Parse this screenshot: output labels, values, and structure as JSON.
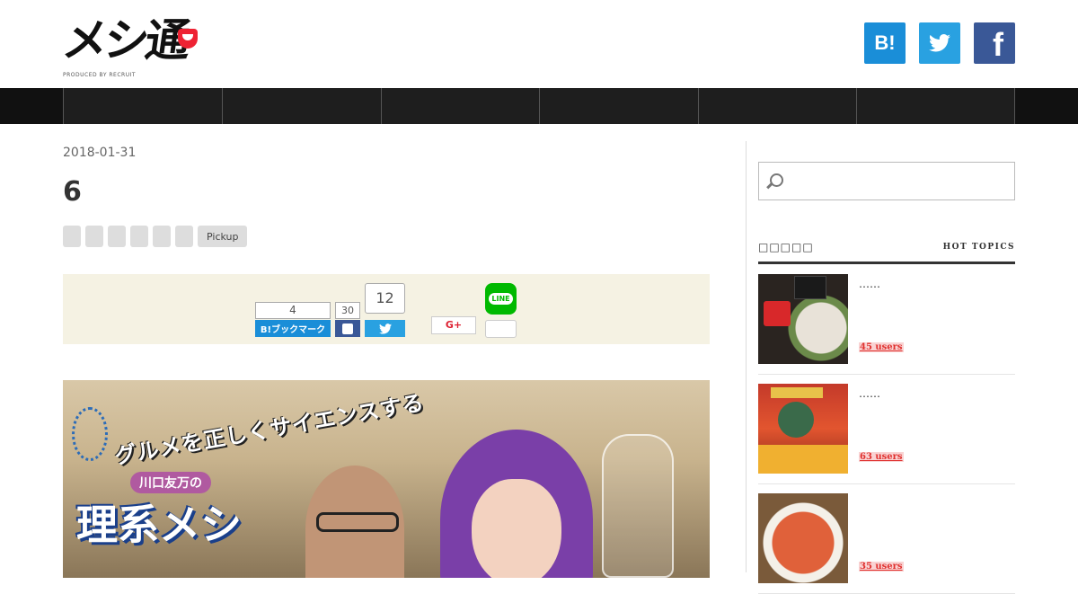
{
  "header": {
    "logo_text": "メシ通",
    "logo_sub": "PRODUCED BY RECRUIT",
    "social": {
      "hatena": "B!",
      "twitter": "twitter-bird",
      "facebook": "f"
    }
  },
  "nav": {
    "items": [
      "",
      "",
      "",
      "",
      "",
      ""
    ]
  },
  "article": {
    "date": "2018-01-31",
    "title": "6",
    "tags": [
      "",
      "",
      "",
      "",
      "",
      "",
      "Pickup"
    ],
    "share": {
      "hatena_count": "4",
      "hatena_label": "B!ブックマーク",
      "facebook_count": "30",
      "twitter_count": "12",
      "google_label": "G+",
      "line_label": "LINE",
      "line_count": ""
    },
    "hero": {
      "line1": "グルメを正しくサイエンスする",
      "subtitle": "川口友万の",
      "line2": "理系メシ"
    }
  },
  "sidebar": {
    "search_placeholder": "",
    "hot_topics_jp": "□□□□□",
    "hot_topics_en": "HOT TOPICS",
    "topics": [
      {
        "title": "……",
        "users": "45 users"
      },
      {
        "title": "……",
        "users": "63 users"
      },
      {
        "title": "",
        "users": "35 users"
      }
    ]
  },
  "colors": {
    "nav_bg": "#111111",
    "hatena": "#1a8ed8",
    "twitter": "#29a1e1",
    "facebook": "#3a5897",
    "share_bg": "#f5f2e3",
    "users_red": "#e0312f"
  }
}
